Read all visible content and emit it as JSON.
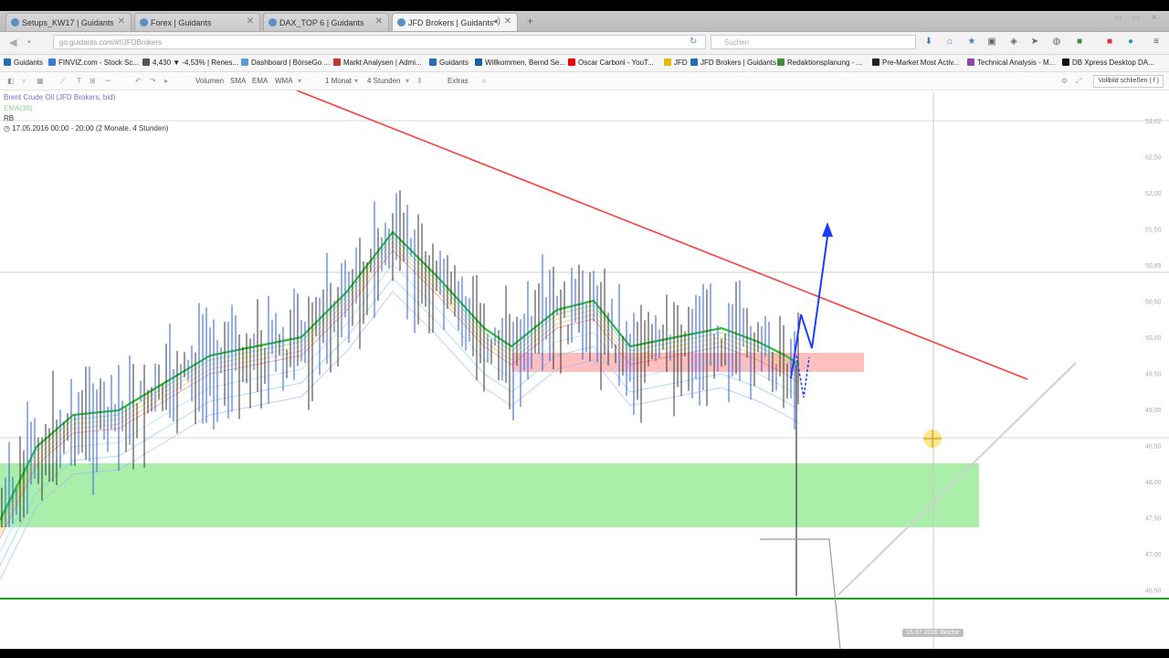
{
  "tabs": [
    {
      "label": "Setups_KW17 | Guidants",
      "active": false
    },
    {
      "label": "Forex | Guidants",
      "active": false
    },
    {
      "label": "DAX_TOP 6 | Guidants",
      "active": false
    },
    {
      "label": "JFD Brokers | Guidants",
      "active": true
    }
  ],
  "address": {
    "url": "go.guidants.com/#!/JFDBrokers",
    "search_placeholder": "Suchen"
  },
  "bookmarks": [
    {
      "label": "Guidants",
      "color": "#2b6cb0"
    },
    {
      "label": "FINVIZ.com - Stock Sc...",
      "color": "#3a7bd5"
    },
    {
      "label": "4,430 ▼ -4,53% | Renes...",
      "color": "#555555"
    },
    {
      "label": "Dashboard | BörseGo ...",
      "color": "#5a9bd4"
    },
    {
      "label": "Markt Analysen | Admi...",
      "color": "#c0392b"
    },
    {
      "label": "Guidants",
      "color": "#2b6cb0"
    },
    {
      "label": "Willkommen, Bernd Se...",
      "color": "#1e5f9e"
    },
    {
      "label": "Oscar Carboni - YouT...",
      "color": "#e60000"
    },
    {
      "label": "JFD",
      "color": "#e6b800"
    },
    {
      "label": "JFD Brokers | Guidants",
      "color": "#2b6cb0"
    },
    {
      "label": "Redaktionsplanung - ...",
      "color": "#3c8c3c"
    },
    {
      "label": "Pre-Market Most Activ...",
      "color": "#222222"
    },
    {
      "label": "Technical Analysis - M...",
      "color": "#8e44ad"
    },
    {
      "label": "DB Xpress Desktop DA...",
      "color": "#111111"
    }
  ],
  "toolbar": {
    "volumen": "Volumen",
    "sma": "SMA",
    "ema": "EMA",
    "wma": "WMA",
    "range": "1 Monat",
    "interval": "4 Stunden",
    "extras": "Extras",
    "fullscreen": "Vollbild schließen ( f )"
  },
  "legend": {
    "instrument": "Brent Crude Oil (JFD Brokers, bid)",
    "indicator": "EMA(38)",
    "rb": "RB",
    "period": "17.05.2016 00:00 - 20:00 (2 Monate, 4 Stunden)"
  },
  "crosshair_date": "15.07.2016 Woche",
  "price_axis_labels": [
    "53,02",
    "52,50",
    "52,00",
    "51,50",
    "50,89",
    "50,50",
    "50,00",
    "49,50",
    "49,00",
    "48,50",
    "48,00",
    "47,50",
    "47,00",
    "46,50"
  ],
  "colors": {
    "trendline": "#ff3b3b",
    "resistance_zone": "#ff8a8a",
    "support_zone": "#8ee88e",
    "arrow": "#1a3cff",
    "baseline": "#1aa31a"
  }
}
